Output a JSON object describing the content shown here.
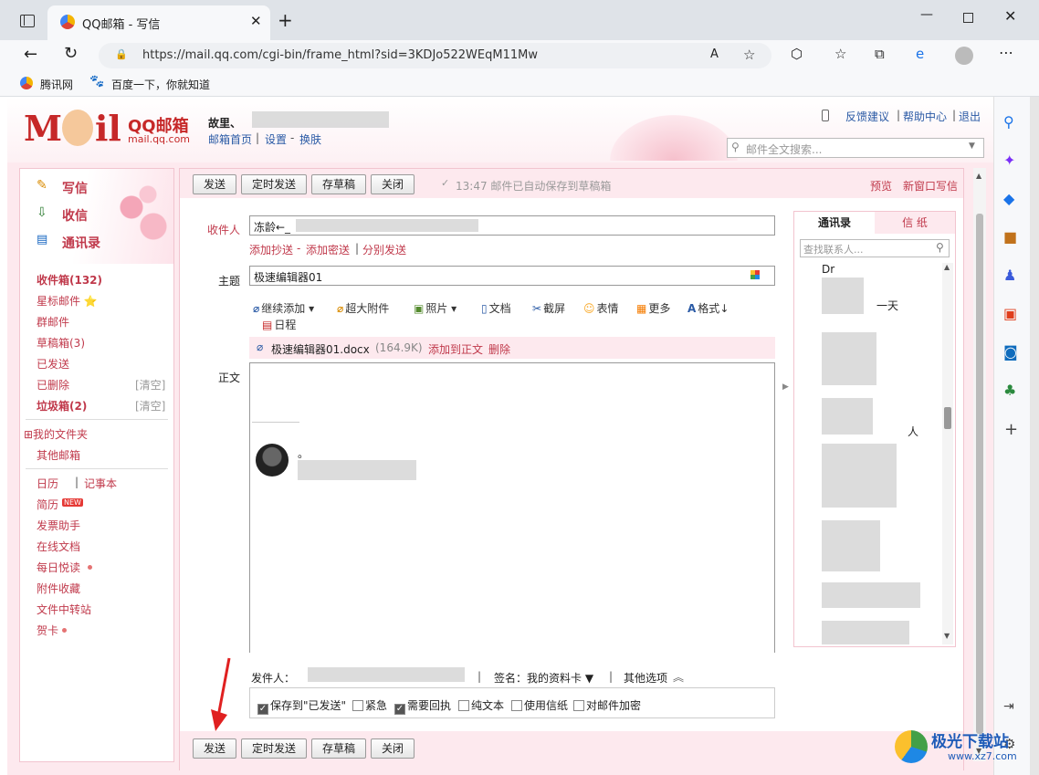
{
  "browser": {
    "tab_title": "QQ邮箱 - 写信",
    "url": "https://mail.qq.com/cgi-bin/frame_html?sid=3KDJo522WEqM11Mw",
    "bookmarks": [
      "腾讯网",
      "百度一下，你就知道"
    ]
  },
  "header": {
    "logo_word": "QQ邮箱",
    "logo_domain": "mail.qq.com",
    "user": "故里、",
    "nav": [
      "邮箱首页",
      "设置",
      "换肤"
    ],
    "top_links": [
      "反馈建议",
      "帮助中心",
      "退出"
    ],
    "search_placeholder": "邮件全文搜索..."
  },
  "sidebar": {
    "actions": [
      "写信",
      "收信",
      "通讯录"
    ],
    "folders": [
      {
        "label": "收件箱(132)",
        "bold": true
      },
      {
        "label": "星标邮件 ⭐"
      },
      {
        "label": "群邮件"
      },
      {
        "label": "草稿箱(3)"
      },
      {
        "label": "已发送"
      },
      {
        "label": "已删除",
        "extra": "[清空]"
      },
      {
        "label": "垃圾箱(2)",
        "bold": true,
        "extra": "[清空]"
      }
    ],
    "my_folders": "⊞我的文件夹",
    "other_mail": "其他邮箱",
    "tools": [
      "日历",
      "记事本",
      "简历",
      "发票助手",
      "在线文档",
      "每日悦读",
      "附件收藏",
      "文件中转站",
      "贺卡"
    ],
    "new_badge": "NEW"
  },
  "compose": {
    "buttons": [
      "发送",
      "定时发送",
      "存草稿",
      "关闭"
    ],
    "autosave": "13:47 邮件已自动保存到草稿箱",
    "preview": "预览",
    "new_window": "新窗口写信",
    "to_label": "收件人",
    "to_value": "冻龄←_",
    "cc_links": [
      "添加抄送",
      "添加密送",
      "分别发送"
    ],
    "subject_label": "主题",
    "subject_value": "极速编辑器01",
    "toolbar": [
      "继续添加",
      "超大附件",
      "照片",
      "文档",
      "截屏",
      "表情",
      "更多",
      "格式",
      "日程"
    ],
    "attachment": {
      "name": "极速编辑器01.docx",
      "size": "(164.9K)",
      "add": "添加到正文",
      "delete": "删除"
    },
    "body_label": "正文",
    "body_mark": "。",
    "sender_label": "发件人：",
    "signature": "签名：我的资料卡 ▼",
    "other_options": "其他选项",
    "options": [
      {
        "label": "保存到\"已发送\"",
        "checked": true
      },
      {
        "label": "紧急",
        "checked": false
      },
      {
        "label": "需要回执",
        "checked": true
      },
      {
        "label": "纯文本",
        "checked": false
      },
      {
        "label": "使用信纸",
        "checked": false
      },
      {
        "label": "对邮件加密",
        "checked": false
      }
    ]
  },
  "contacts": {
    "tabs": [
      "通讯录",
      "信 纸"
    ],
    "search_placeholder": "查找联系人...",
    "fragments": [
      "Dr",
      "一天",
      "人"
    ]
  },
  "watermark": {
    "text": "极光下载站",
    "url": "www.xz7.com"
  }
}
